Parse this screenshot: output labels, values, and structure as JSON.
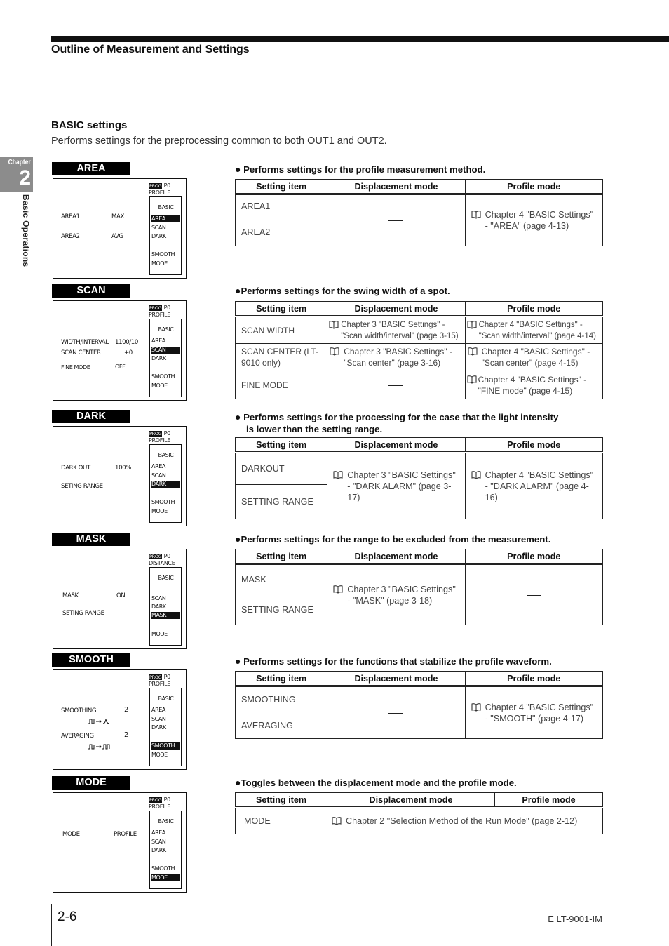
{
  "header": {
    "section_title": "Outline of Measurement and Settings"
  },
  "chapter_tab": {
    "label": "Chapter",
    "number": "2",
    "side_title": "Basic Operations"
  },
  "basic": {
    "title": "BASIC settings",
    "intro": "Performs settings for the preprocessing common to both OUT1 and OUT2."
  },
  "table_headers": {
    "setting_item": "Setting item",
    "displacement_mode": "Displacement mode",
    "profile_mode": "Profile mode"
  },
  "icons": {
    "reference": "book-icon",
    "bullet": "●"
  },
  "sections": [
    {
      "label": "AREA",
      "screen": {
        "prog_tag": "PROG",
        "prog_num": "P0",
        "mode_line": "PROFILE",
        "menu": [
          "BASIC",
          "AREA",
          "SCAN",
          "DARK",
          "",
          "SMOOTH",
          "MODE"
        ],
        "selected": "AREA",
        "rows": [
          {
            "name": "AREA1",
            "value": "MAX"
          },
          {
            "name": "AREA2",
            "value": "AVG"
          }
        ]
      },
      "description": "Performs settings for the profile measurement method.",
      "items": [
        "AREA1",
        "AREA2"
      ],
      "displacement": "—",
      "profile": "Chapter 4 \"BASIC Settings\" - \"AREA\" (page 4-13)"
    },
    {
      "label": "SCAN",
      "screen": {
        "prog_tag": "PROG",
        "prog_num": "P0",
        "mode_line": "PROFILE",
        "menu": [
          "BASIC",
          "AREA",
          "SCAN",
          "DARK",
          "",
          "SMOOTH",
          "MODE"
        ],
        "selected": "SCAN",
        "rows": [
          {
            "name": "WIDTH/INTERVAL",
            "value": "1100/10"
          },
          {
            "name": "SCAN CENTER",
            "value": "+0"
          },
          {
            "name": "FINE MODE",
            "value": "OFF"
          }
        ]
      },
      "description": "Performs settings for the swing width of a spot.",
      "rows": [
        {
          "item": "SCAN WIDTH",
          "displacement": "Chapter 3 \"BASIC Settings\" - \"Scan width/interval\" (page 3-15)",
          "profile": "Chapter 4 \"BASIC Settings\" - \"Scan width/interval\" (page 4-14)"
        },
        {
          "item": "SCAN CENTER (LT-9010 only)",
          "displacement": "Chapter 3 \"BASIC Settings\" - \"Scan center\" (page 3-16)",
          "profile": "Chapter 4 \"BASIC Settings\" - \"Scan center\" (page 4-15)"
        },
        {
          "item": "FINE MODE",
          "displacement": "—",
          "profile": "Chapter 4 \"BASIC Settings\" - \"FINE mode\" (page 4-15)"
        }
      ]
    },
    {
      "label": "DARK",
      "screen": {
        "prog_tag": "PROG",
        "prog_num": "P0",
        "mode_line": "PROFILE",
        "menu": [
          "BASIC",
          "AREA",
          "SCAN",
          "DARK",
          "",
          "SMOOTH",
          "MODE"
        ],
        "selected": "DARK",
        "rows": [
          {
            "name": "DARK OUT",
            "value": "100%"
          },
          {
            "name": "SETING RANGE",
            "value": ""
          }
        ]
      },
      "description": "Performs settings for the processing for the case that the light intensity",
      "description_cont": "is lower than the setting range.",
      "items": [
        "DARKOUT",
        "SETTING RANGE"
      ],
      "displacement": "Chapter 3 \"BASIC Settings\" - \"DARK ALARM\" (page 3-17)",
      "profile": "Chapter 4 \"BASIC Settings\" - \"DARK ALARM\" (page 4-16)"
    },
    {
      "label": "MASK",
      "screen": {
        "prog_tag": "PROG",
        "prog_num": "P0",
        "mode_line": "DISTANCE",
        "menu": [
          "BASIC",
          "",
          "SCAN",
          "DARK",
          "MASK",
          "",
          "MODE"
        ],
        "selected": "MASK",
        "rows": [
          {
            "name": "MASK",
            "value": "ON"
          },
          {
            "name": "SETING RANGE",
            "value": ""
          }
        ]
      },
      "description": "Performs settings for the range to be excluded from the measurement.",
      "items": [
        "MASK",
        "SETTING RANGE"
      ],
      "displacement": "Chapter 3 \"BASIC Settings\" - \"MASK\" (page 3-18)",
      "profile": "—"
    },
    {
      "label": "SMOOTH",
      "screen": {
        "prog_tag": "PROG",
        "prog_num": "P0",
        "mode_line": "PROFILE",
        "menu": [
          "BASIC",
          "AREA",
          "SCAN",
          "DARK",
          "",
          "SMOOTH",
          "MODE"
        ],
        "selected": "SMOOTH",
        "rows": [
          {
            "name": "SMOOTHING",
            "value": "2"
          },
          {
            "name": "AVERAGING",
            "value": "2"
          }
        ]
      },
      "description": "Performs settings for the functions that stabilize the profile waveform.",
      "items": [
        "SMOOTHING",
        "AVERAGING"
      ],
      "displacement": "—",
      "profile": "Chapter 4 \"BASIC Settings\" - \"SMOOTH\" (page 4-17)"
    },
    {
      "label": "MODE",
      "screen": {
        "prog_tag": "PROG",
        "prog_num": "P0",
        "mode_line": "PROFILE",
        "menu": [
          "BASIC",
          "AREA",
          "SCAN",
          "DARK",
          "",
          "SMOOTH",
          "MODE"
        ],
        "selected": "MODE",
        "rows": [
          {
            "name": "MODE",
            "value": "PROFILE"
          }
        ]
      },
      "description": "Toggles between the displacement mode and the profile mode.",
      "items": [
        "MODE"
      ],
      "combined": "Chapter 2 \"Selection Method of the Run Mode\" (page 2-12)"
    }
  ],
  "footer": {
    "page_number": "2-6",
    "doc_code": "E LT-9001-IM"
  }
}
